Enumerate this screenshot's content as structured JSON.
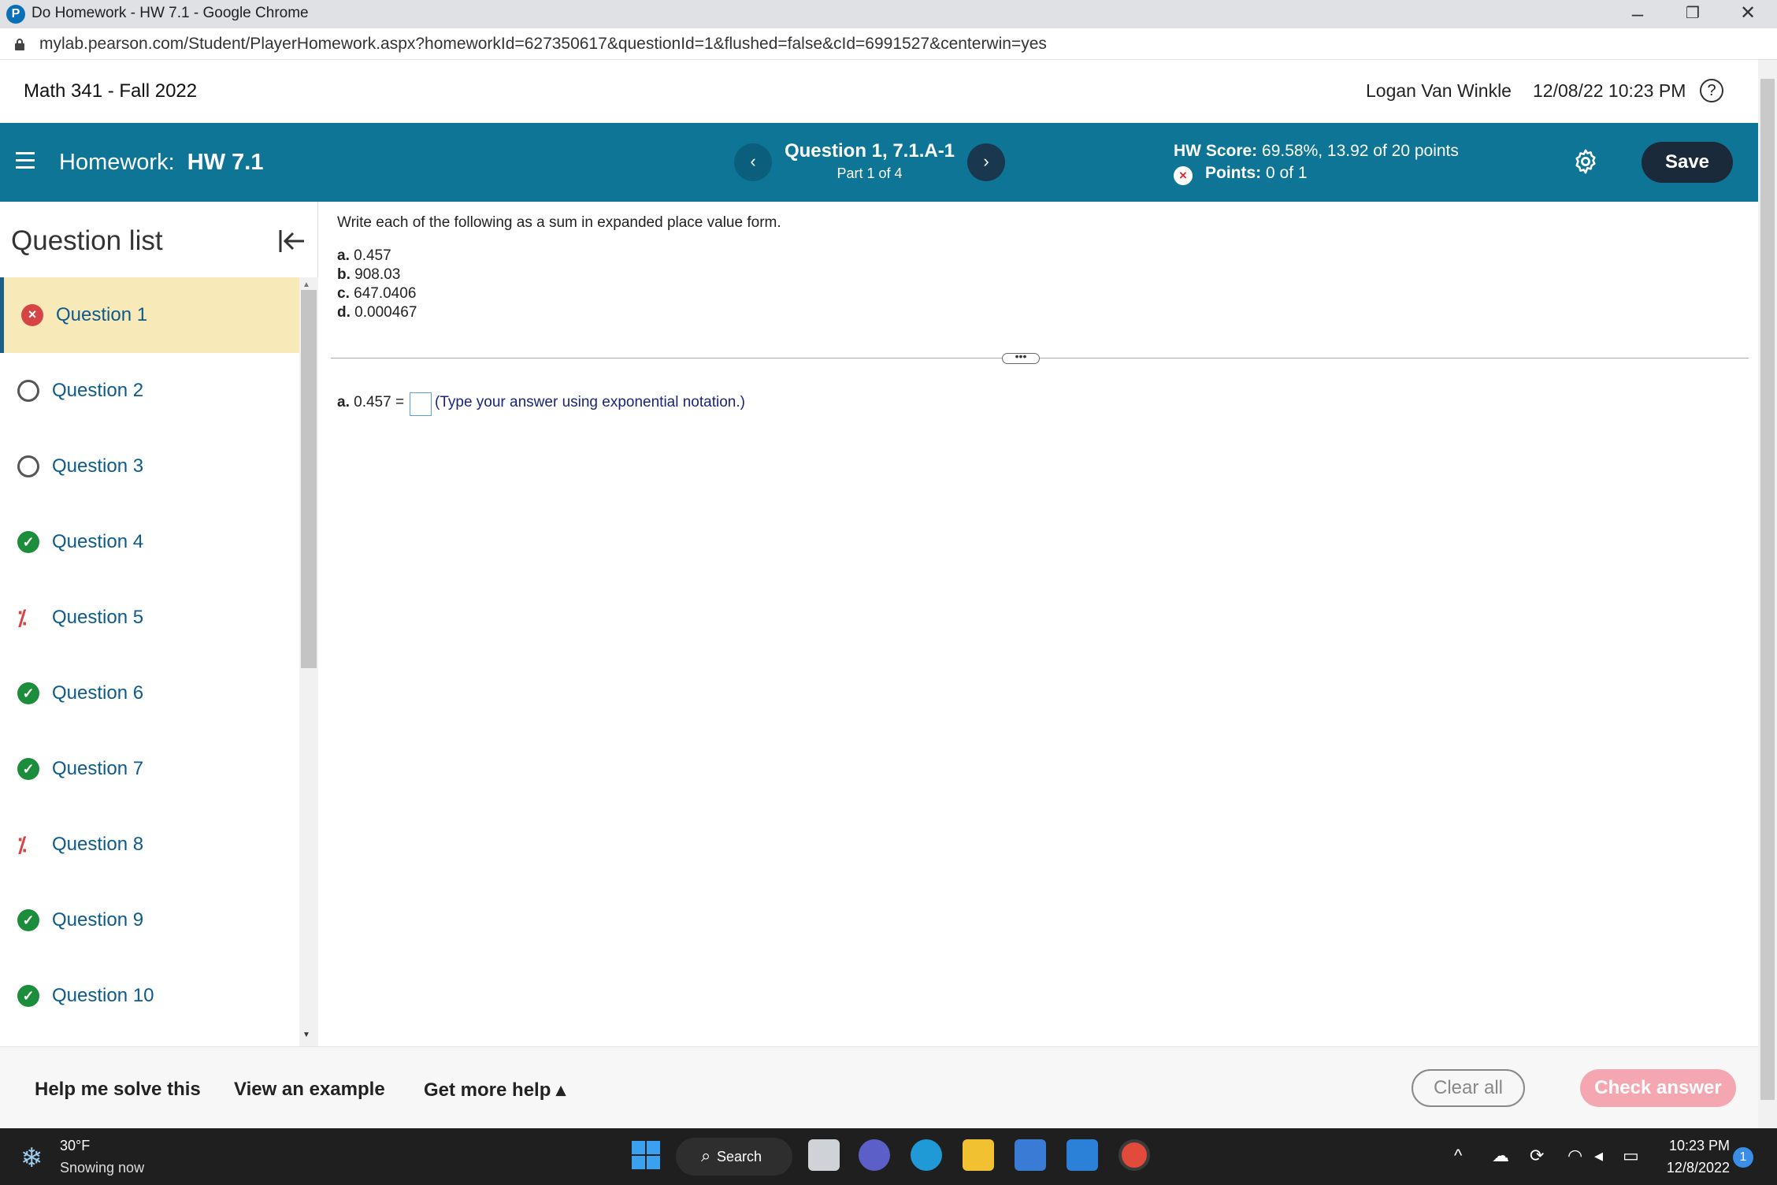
{
  "browser": {
    "window_title": "Do Homework - HW 7.1 - Google Chrome",
    "url": "mylab.pearson.com/Student/PlayerHomework.aspx?homeworkId=627350617&questionId=1&flushed=false&cId=6991527&centerwin=yes"
  },
  "header": {
    "course": "Math 341 - Fall 2022",
    "user": "Logan Van Winkle",
    "datetime": "12/08/22 10:23 PM",
    "help_glyph": "?"
  },
  "homework_bar": {
    "label": "Homework:",
    "name": "HW 7.1",
    "question_title": "Question 1, 7.1.A-1",
    "part": "Part 1 of 4",
    "hw_score_label": "HW Score:",
    "hw_score_value": "69.58%, 13.92 of 20 points",
    "points_label": "Points:",
    "points_value": "0 of 1",
    "save_label": "Save"
  },
  "sidebar": {
    "title": "Question list",
    "questions": [
      {
        "label": "Question 1",
        "status": "incorrect",
        "active": true
      },
      {
        "label": "Question 2",
        "status": "unanswered"
      },
      {
        "label": "Question 3",
        "status": "unanswered"
      },
      {
        "label": "Question 4",
        "status": "correct"
      },
      {
        "label": "Question 5",
        "status": "partial"
      },
      {
        "label": "Question 6",
        "status": "correct"
      },
      {
        "label": "Question 7",
        "status": "correct"
      },
      {
        "label": "Question 8",
        "status": "partial"
      },
      {
        "label": "Question 9",
        "status": "correct"
      },
      {
        "label": "Question 10",
        "status": "correct"
      }
    ]
  },
  "question": {
    "instruction": "Write each of the following as a sum in expanded place value form.",
    "items": [
      {
        "letter": "a.",
        "value": "0.457"
      },
      {
        "letter": "b.",
        "value": "908.03"
      },
      {
        "letter": "c.",
        "value": "647.0406"
      },
      {
        "letter": "d.",
        "value": "0.000467"
      }
    ],
    "answer_prefix_letter": "a.",
    "answer_prefix": "0.457 =",
    "answer_value": "",
    "answer_hint": "(Type your answer using exponential notation.)"
  },
  "footer": {
    "help_solve": "Help me solve this",
    "view_example": "View an example",
    "more_help": "Get more help ▴",
    "clear_all": "Clear all",
    "check_answer": "Check answer"
  },
  "taskbar": {
    "temperature": "30°F",
    "weather": "Snowing now",
    "search": "Search",
    "time": "10:23 PM",
    "date": "12/8/2022",
    "notifications": "1"
  }
}
